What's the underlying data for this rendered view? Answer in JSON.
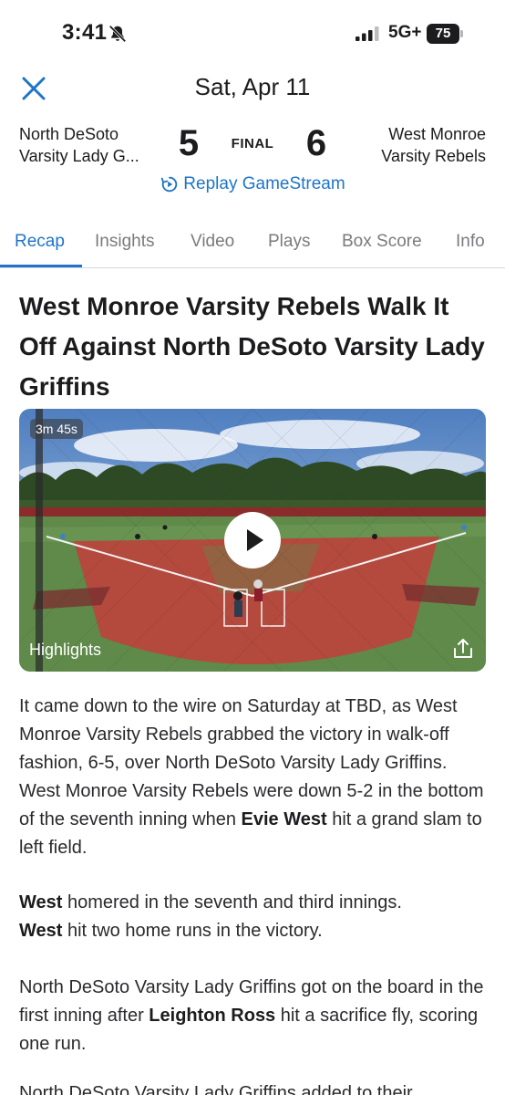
{
  "status_bar": {
    "time": "3:41",
    "network": "5G+",
    "battery": "75",
    "icons": [
      "bell-slash-icon",
      "signal-icon",
      "battery-icon"
    ]
  },
  "header": {
    "date": "Sat, Apr 11",
    "close_icon": "close-icon"
  },
  "scoreboard": {
    "home_team_line1": "North DeSoto",
    "home_team_line2": "Varsity Lady G...",
    "home_score": "5",
    "status": "FINAL",
    "away_score": "6",
    "away_team_line1": "West Monroe",
    "away_team_line2": "Varsity Rebels",
    "replay_label": "Replay GameStream"
  },
  "tabs": [
    {
      "label": "Recap",
      "active": true
    },
    {
      "label": "Insights",
      "active": false
    },
    {
      "label": "Video",
      "active": false
    },
    {
      "label": "Plays",
      "active": false
    },
    {
      "label": "Box Score",
      "active": false
    },
    {
      "label": "Info",
      "active": false
    }
  ],
  "article": {
    "headline": "West Monroe Varsity Rebels Walk It Off Against North DeSoto Varsity Lady Griffins",
    "video": {
      "duration": "3m 45s",
      "label": "Highlights"
    },
    "p1_text": "It came down to the wire on Saturday at TBD, as West Monroe Varsity Rebels grabbed the victory in walk-off fashion, 6-5, over North DeSoto Varsity Lady Griffins. West Monroe Varsity Rebels were down 5-2 in the bottom of the seventh inning when ",
    "p1_bold": "Evie West",
    "p1_end": " hit a grand slam to left field.",
    "p2_bold1": "West",
    "p2_text1": " homered in the seventh and third innings.",
    "p2_bold2": "West",
    "p2_text2": " hit two home runs in the victory.",
    "p3_text": "North DeSoto Varsity Lady Griffins got on the board in the first inning after ",
    "p3_bold": "Leighton Ross",
    "p3_end": " hit a sacrifice fly, scoring one run.",
    "p4_text": "North DeSoto Varsity Lady Griffins added to their"
  },
  "colors": {
    "accent": "#1e74c9",
    "text": "#1c1c1e",
    "muted": "#7a7a80"
  }
}
